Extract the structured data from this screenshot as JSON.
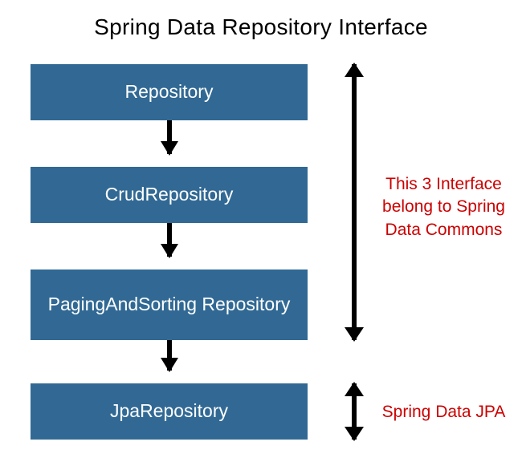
{
  "title": "Spring Data Repository Interface",
  "boxes": {
    "b1": "Repository",
    "b2": "CrudRepository",
    "b3": "PagingAndSorting Repository",
    "b4": "JpaRepository"
  },
  "annotations": {
    "commons": "This 3 Interface belong to Spring Data Commons",
    "jpa": "Spring Data JPA"
  },
  "colors": {
    "box_bg": "#316994",
    "annotation": "#cc0000"
  }
}
